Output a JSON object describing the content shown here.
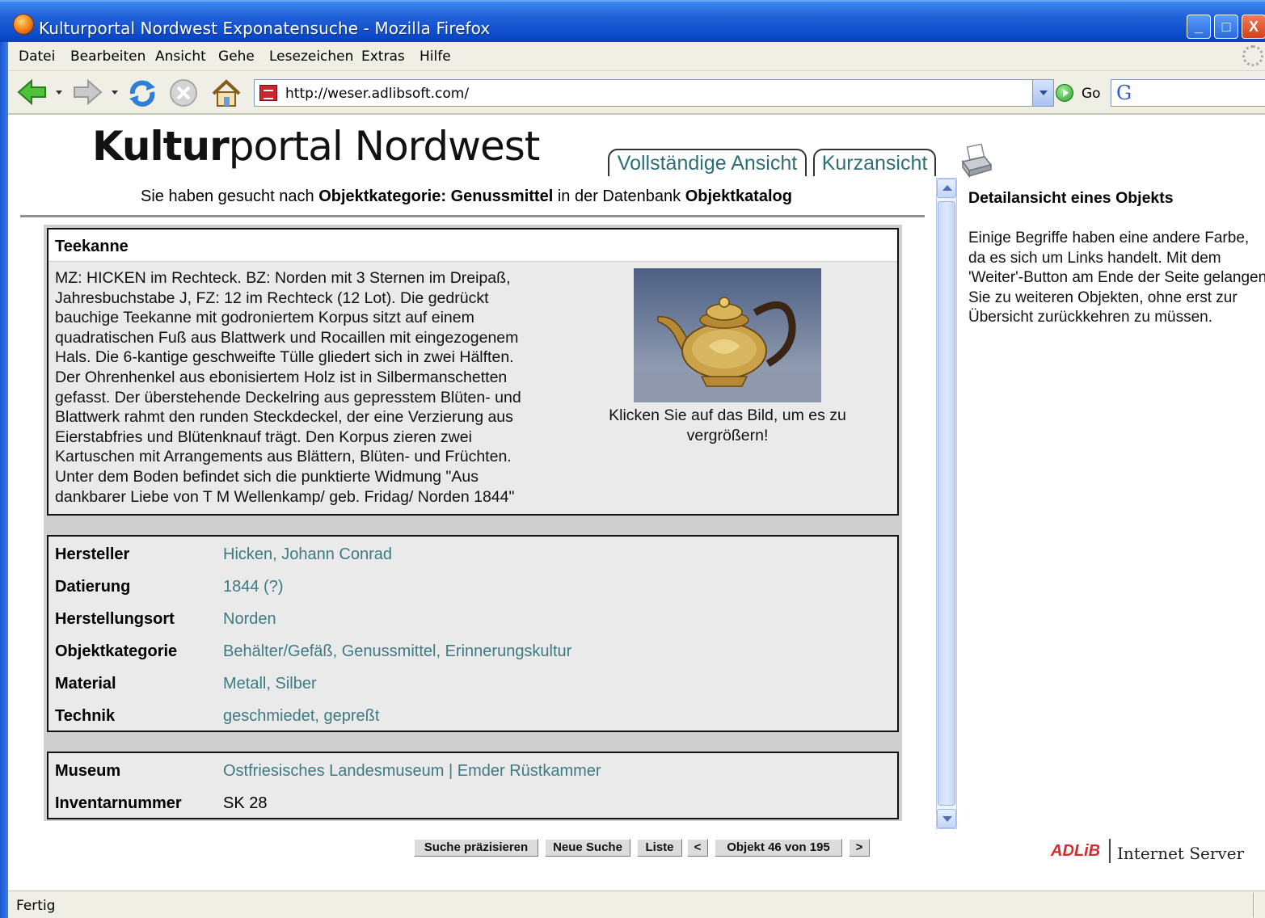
{
  "window": {
    "title": "Kulturportal Nordwest Exponatensuche - Mozilla Firefox",
    "min_label": "_",
    "max_label": "□",
    "close_label": "X"
  },
  "menu": {
    "items": [
      {
        "label": "Datei"
      },
      {
        "label": "Bearbeiten"
      },
      {
        "label": "Ansicht"
      },
      {
        "label": "Gehe"
      },
      {
        "label": "Lesezeichen"
      },
      {
        "label": "Extras"
      },
      {
        "label": "Hilfe"
      }
    ]
  },
  "toolbar": {
    "url": "http://weser.adlibsoft.com/",
    "go_label": "Go",
    "icons": [
      "back-icon",
      "forward-icon",
      "reload-icon",
      "stop-icon",
      "home-icon"
    ]
  },
  "page": {
    "logo_bold": "Kultur",
    "logo_rest": "portal Nordwest",
    "tabs": {
      "full": "Vollständige Ansicht",
      "short": "Kurzansicht"
    },
    "search": {
      "prefix": "Sie haben gesucht nach ",
      "term": "Objektkategorie: Genussmittel",
      "middle": " in der Datenbank ",
      "database": "Objektkatalog"
    },
    "object": {
      "title": "Teekanne",
      "description": "MZ: HICKEN im Rechteck. BZ: Norden mit 3 Sternen im Dreipaß, Jahresbuchstabe J, FZ: 12 im Rechteck (12 Lot). Die gedrückt bauchige Teekanne mit godroniertem Korpus sitzt auf einem quadratischen Fuß aus Blattwerk und Rocaillen mit eingezogenem Hals. Die 6-kantige geschweifte Tülle gliedert sich in zwei Hälften. Der Ohrenhenkel aus ebonisiertem Holz ist in Silbermanschetten gefasst. Der überstehende Deckelring aus gepresstem Blüten- und Blattwerk rahmt den runden Steckdeckel, der eine Verzierung aus Eierstabfries und Blütenknauf trägt. Den Korpus zieren zwei Kartuschen mit Arrangements aus Blättern, Blüten- und Früchten. Unter dem Boden befindet sich die punktierte Widmung \"Aus dankbarer Liebe von T M Wellenkamp/ geb. Fridag/ Norden 1844\"",
      "image_caption": "Klicken Sie auf das Bild, um es zu vergrößern!"
    },
    "details": {
      "hersteller_label": "Hersteller",
      "hersteller": "Hicken, Johann Conrad",
      "datierung_label": "Datierung",
      "datierung": "1844 (?)",
      "herstellungsort_label": "Herstellungsort",
      "herstellungsort": "Norden",
      "objektkategorie_label": "Objektkategorie",
      "objektkategorie_1": "Behälter/Gefäß",
      "objektkategorie_2": "Genussmittel",
      "objektkategorie_3": "Erinnerungskultur",
      "material_label": "Material",
      "material_1": "Metall",
      "material_2": "Silber",
      "technik_label": "Technik",
      "technik_1": "geschmiedet",
      "technik_2": "gepreßt",
      "comma": ", "
    },
    "museum": {
      "museum_label": "Museum",
      "museum": "Ostfriesisches Landesmuseum | Emder Rüstkammer",
      "inventar_label": "Inventarnummer",
      "inventar": "SK 28"
    },
    "sidebar": {
      "title": "Detailansicht eines Objekts",
      "text": "Einige Begriffe haben eine andere Farbe, da es sich um Links handelt. Mit dem 'Weiter'-Button am Ende der Seite gelangen Sie zu weiteren Objekten, ohne erst zur Übersicht zurückkehren zu müssen."
    },
    "buttons": {
      "refine": "Suche präzisieren",
      "new_search": "Neue Suche",
      "list": "Liste",
      "prev": "<",
      "position": "Objekt 46 von 195",
      "next": ">"
    },
    "footer": {
      "adlib": "ADLiB",
      "server": "Internet Server"
    }
  },
  "status": {
    "text": "Fertig"
  },
  "colors": {
    "link": "#3d7a82",
    "titlebar": "#0a47c8",
    "adlib_red": "#d42a2a"
  }
}
